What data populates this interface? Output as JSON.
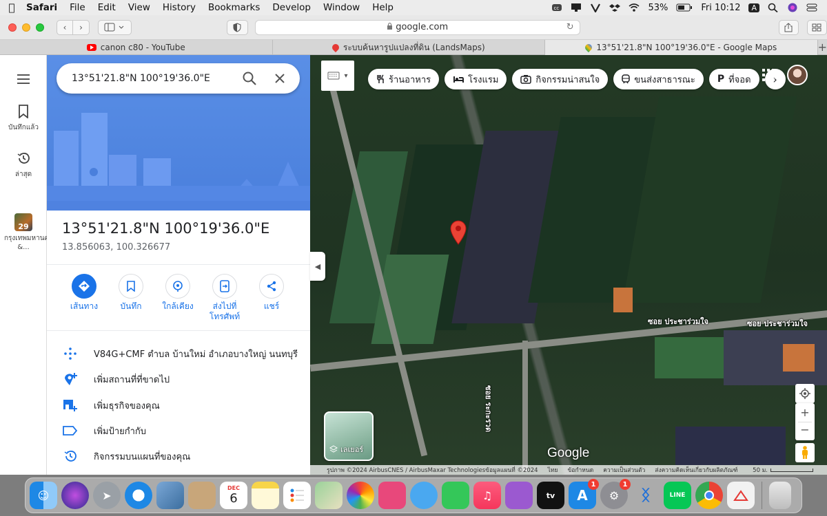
{
  "menubar": {
    "app_name": "Safari",
    "items": [
      "File",
      "Edit",
      "View",
      "History",
      "Bookmarks",
      "Develop",
      "Window",
      "Help"
    ],
    "battery": "53%",
    "clock": "Fri 10:12",
    "input_source": "A"
  },
  "toolbar": {
    "url": "google.com"
  },
  "tabs": [
    {
      "label": "canon c80 - YouTube",
      "icon": "youtube-icon"
    },
    {
      "label": "ระบบค้นหารูปแปลงที่ดิน (LandsMaps)",
      "icon": "location-pin-icon"
    },
    {
      "label": "13°51'21.8\"N 100°19'36.0\"E - Google Maps",
      "icon": "google-maps-icon"
    }
  ],
  "rail": {
    "saved_label": "บันทึกแล้ว",
    "recent_label": "ล่าสุด",
    "recent_place_label": "กรุงเทพมหานคร &...",
    "recent_place_badge": "29"
  },
  "panel": {
    "search_value": "13°51'21.8\"N 100°19'36.0\"E",
    "title": "13°51'21.8\"N 100°19'36.0\"E",
    "subtitle": "13.856063, 100.326677",
    "actions": [
      {
        "label": "เส้นทาง",
        "icon": "directions-icon"
      },
      {
        "label": "บันทึก",
        "icon": "bookmark-icon"
      },
      {
        "label": "ใกล้เคียง",
        "icon": "nearby-icon"
      },
      {
        "label": "ส่งไปที่โทรศัพท์",
        "icon": "send-to-phone-icon"
      },
      {
        "label": "แชร์",
        "icon": "share-icon"
      }
    ],
    "info_rows": [
      {
        "label": "V84G+CMF ตำบล บ้านใหม่ อำเภอบางใหญ่ นนทบุรี",
        "icon": "plus-code-icon"
      },
      {
        "label": "เพิ่มสถานที่ที่ขาดไป",
        "icon": "add-place-icon"
      },
      {
        "label": "เพิ่มธุรกิจของคุณ",
        "icon": "add-business-icon"
      },
      {
        "label": "เพิ่มป้ายกำกับ",
        "icon": "label-icon"
      },
      {
        "label": "กิจกรรมบนแผนที่ของคุณ",
        "icon": "history-icon"
      }
    ]
  },
  "map": {
    "chips": [
      {
        "label": "ร้านอาหาร",
        "icon": "restaurant-icon"
      },
      {
        "label": "โรงแรม",
        "icon": "hotel-icon"
      },
      {
        "label": "กิจกรรมน่าสนใจ",
        "icon": "camera-icon"
      },
      {
        "label": "ขนส่งสาธารณะ",
        "icon": "transit-icon"
      },
      {
        "label": "ที่จอด",
        "icon": "parking-icon"
      }
    ],
    "street_labels": [
      "ซอย ประชาร่วมใจ",
      "ซอย ประชาร่วมใจ",
      "ซอย ระกะรวด"
    ],
    "layers_label": "เลเยอร์",
    "google_logo": "Google",
    "attribution": {
      "imagery": "รูปภาพ ©2024 AirbusCNES / AirbusMaxar Technologiesข้อมูลแผนที่ ©2024",
      "language": "ไทย",
      "terms": "ข้อกำหนด",
      "privacy": "ความเป็นส่วนตัว",
      "feedback": "ส่งความคิดเห็นเกี่ยวกับผลิตภัณฑ์",
      "scale": "50 ม."
    },
    "pin_color": "#ea4335"
  },
  "dock": {
    "calendar_month": "DEC",
    "calendar_day": "6",
    "appstore_badge": "1",
    "settings_badge": "1",
    "apps": [
      "finder-icon",
      "siri-icon",
      "launchpad-icon",
      "safari-icon",
      "preview-icon",
      "contacts-icon",
      "calendar-icon",
      "notes-icon",
      "reminders-icon",
      "maps-icon",
      "photos-icon",
      "keynote-icon",
      "messages-icon",
      "facetime-icon",
      "music-icon",
      "podcasts-icon",
      "apple-tv-icon",
      "app-store-icon",
      "system-preferences-icon",
      "bluetooth-icon",
      "line-icon",
      "chrome-icon",
      "pdf-app-icon",
      "trash-icon"
    ]
  }
}
